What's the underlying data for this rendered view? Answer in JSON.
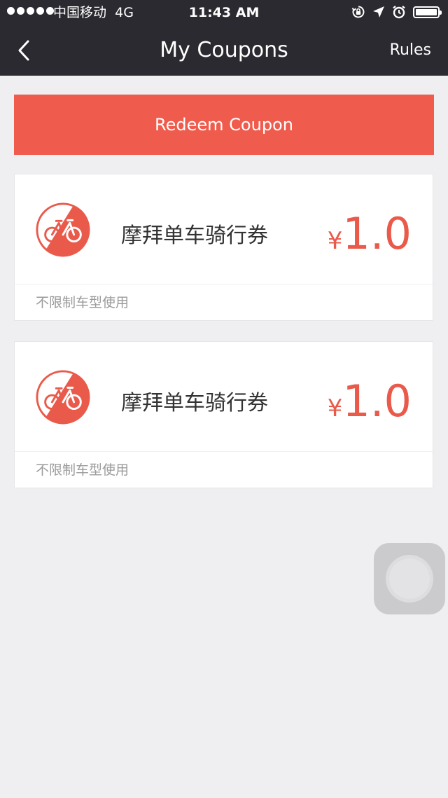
{
  "status_bar": {
    "carrier": "中国移动",
    "network": "4G",
    "time": "11:43 AM",
    "icons": [
      "rotation-lock-icon",
      "location-arrow-icon",
      "alarm-icon",
      "battery-icon"
    ]
  },
  "nav": {
    "back_icon": "chevron-left-icon",
    "title": "My Coupons",
    "rules_label": "Rules"
  },
  "redeem": {
    "label": "Redeem Coupon"
  },
  "coupons": [
    {
      "icon": "bike-logo-icon",
      "name": "摩拜单车骑行券",
      "currency": "¥",
      "amount": "1.0",
      "note": "不限制车型使用"
    },
    {
      "icon": "bike-logo-icon",
      "name": "摩拜单车骑行券",
      "currency": "¥",
      "amount": "1.0",
      "note": "不限制车型使用"
    }
  ],
  "colors": {
    "nav_bg": "#2a2a30",
    "accent": "#ef5b4c",
    "page_bg": "#efeef0"
  }
}
